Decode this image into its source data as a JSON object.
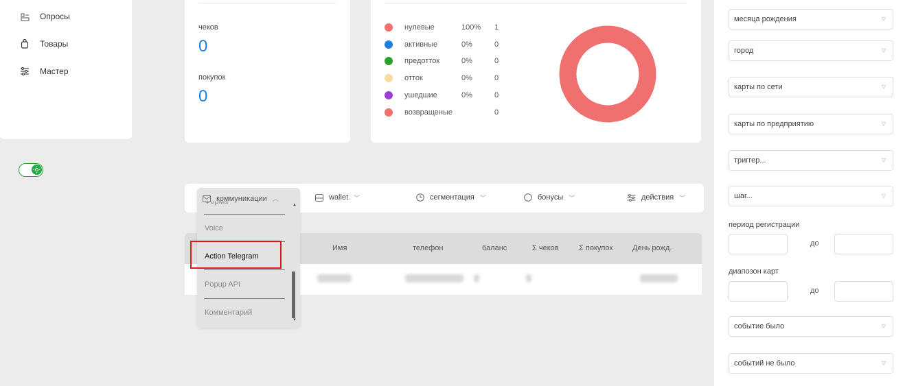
{
  "nav": [
    {
      "label": "Опросы",
      "icon": "survey-icon"
    },
    {
      "label": "Товары",
      "icon": "bag-icon"
    },
    {
      "label": "Мастер",
      "icon": "sliders-icon"
    }
  ],
  "stats": {
    "checks_label": "чеков",
    "checks_value": "0",
    "purchases_label": "покупок",
    "purchases_value": "0"
  },
  "legend": [
    {
      "name": "нулевые",
      "pct": "100%",
      "count": "1",
      "color": "#f07070"
    },
    {
      "name": "активные",
      "pct": "0%",
      "count": "0",
      "color": "#1e7fe0"
    },
    {
      "name": "предотток",
      "pct": "0%",
      "count": "0",
      "color": "#2ca02c"
    },
    {
      "name": "отток",
      "pct": "0%",
      "count": "0",
      "color": "#fcd9a0"
    },
    {
      "name": "ушедшие",
      "pct": "0%",
      "count": "0",
      "color": "#9b3fd6"
    },
    {
      "name": "возвращеные",
      "pct": "",
      "count": "0",
      "color": "#f07070"
    }
  ],
  "donut": {
    "color": "#f07070",
    "share": 1.0
  },
  "tabs": [
    {
      "label": "коммуникации",
      "icon": "mail-icon"
    },
    {
      "label": "wallet",
      "icon": "wallet-icon"
    },
    {
      "label": "сегментация",
      "icon": "clock-icon"
    },
    {
      "label": "бонусы",
      "icon": "circle-icon"
    },
    {
      "label": "действия",
      "icon": "sliders-icon"
    }
  ],
  "table": {
    "headers": [
      "Имя",
      "телефон",
      "баланс",
      "Σ чеков",
      "Σ покупок",
      "День рожд."
    ]
  },
  "dropdown": {
    "partial": "Форма",
    "items": [
      "Voice",
      "Action Telegram",
      "Popup API",
      "Комментарий"
    ]
  },
  "filters": {
    "selects_top": [
      "месяца рождения",
      "город",
      "карты по сети",
      "карты по предприятию",
      "триггер...",
      "шаг..."
    ],
    "reg_period_label": "период регистрации",
    "cards_range_label": "диапозон карт",
    "to_label": "до",
    "selects_bottom": [
      "событие было",
      "событий не было"
    ]
  },
  "colors": {
    "accent": "#1e7fe0",
    "highlight": "#e0191b",
    "toggle": "#27a745"
  }
}
